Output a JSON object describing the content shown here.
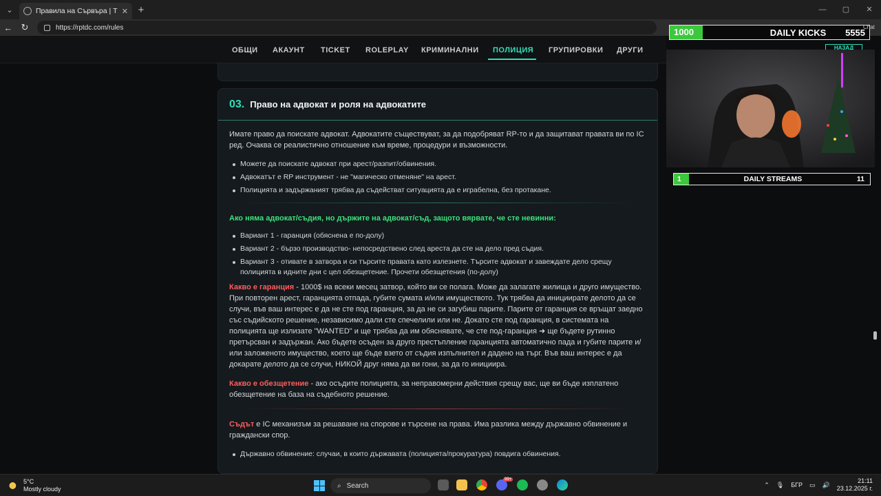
{
  "browser": {
    "tab_title": "Правила на Сървъра | TDC Roleplay",
    "url": "https://rptdc.com/rules",
    "new_tab": "+",
    "window_controls": [
      "—",
      "▢",
      "✕"
    ]
  },
  "site_nav": {
    "items": [
      "ОБЩИ",
      "АКАУНТ",
      "TICKET",
      "ROLEPLAY",
      "КРИМИНАЛНИ",
      "ПОЛИЦИЯ",
      "ГРУПИРОВКИ",
      "ДРУГИ"
    ],
    "active": "ПОЛИЦИЯ"
  },
  "section": {
    "number": "03.",
    "title": "Право на адвокат и роля на адвокатите",
    "intro": "Имате право да поискате адвокат. Адвокатите съществуват, за да подобряват RP-то и да защитават правата ви по IC ред. Очаква се реалистично отношение към време, процедури и възможности.",
    "bullets1": [
      "Можете да поискате адвокат при арест/разпит/обвинения.",
      "Адвокатът е RP инструмент - не \"магическо отменяне\" на арест.",
      "Полицията и задържаният трябва да съдействат ситуацията да е играбелна, без протакане."
    ],
    "green_heading": "Ако няма адвокат/съдия, но държите на адвокат/съд, защото вярвате, че сте невинни:",
    "bullets2": [
      "Вариант 1 - гаранция (обяснена е по-долу)",
      "Вариант 2 - бързо производство- непосредствено след ареста да сте на дело пред съдия.",
      "Вариант 3 - отивате в затвора и си търсите правата като излезнете. Търсите адвокат и завеждате дело срещу полицията в идните дни с цел обезщетение. Прочети обезщетения (по-долу)"
    ],
    "guarantee_label": "Какво е гаранция",
    "guarantee_text": " - 1000$ на всеки месец затвор, който ви се полага. Може да залагате жилища и друго имущество. При повторен арест, гаранцията отпада, губите сумата и/или имуществото. Тук трябва да инициирате делото да се случи, във ваш интерес е да не сте под гаранция, за да не си загубиш парите. Парите от гаранция се връщат заедно със съдийското решение, независимо дали сте спечелили или не. Докато сте под гаранция, в системата на полицията ще излизате \"WANTED\" и ще трябва да им обяснявате, че сте под-гаранция ➜ ще бъдете рутинно претърсван и задържан. Ако бъдете осъден за друго престъпление гаранцията автоматично пада и губите парите и/или заложеното имущество, което ще бъде взето от съдия изпълнител и дадено на търг. Във ваш интерес е да докарате делото да се случи, НИКОЙ друг няма да ви гони, за да го инициира.",
    "compensation_label": "Какво е обезщетение",
    "compensation_text": " - ако осъдите полицията, за неправомерни действия срещу вас, ще ви бъде изплатено обезщетение на база на съдебното решение.",
    "court_label": "Съдът",
    "court_text": " е IC механизъм за решаване на спорове и търсене на права. Има разлика между държавно обвинение и граждански спор.",
    "bullets3": [
      "Държавно обвинение: случаи, в които държавата (полицията/прокуратура) повдига обвинения."
    ]
  },
  "overlay": {
    "kicks_count": "1000",
    "kicks_label": "DAILY KICKS",
    "kicks_value": "5555",
    "chat_label": "Chat",
    "streams_count": "1",
    "streams_label": "DAILY STREAMS",
    "streams_value": "11",
    "side_button": "НАЗАД"
  },
  "taskbar": {
    "temp": "5°C",
    "weather": "Mostly cloudy",
    "search": "Search",
    "lang": "БГР",
    "time": "21:11",
    "date": "23.12.2025 г.",
    "badge": "99+"
  }
}
